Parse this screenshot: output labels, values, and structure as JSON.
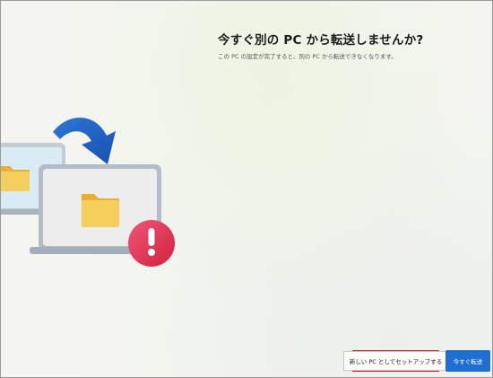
{
  "header": {
    "title": "今すぐ別の PC から転送しませんか?",
    "subtitle": "この PC の設定が完了すると、別の PC から転送できなくなります。"
  },
  "footer": {
    "setup_new_label": "新しい PC としてセットアップする",
    "transfer_now_label": "今すぐ転送"
  },
  "colors": {
    "accent": "#1f6fd1",
    "highlight_border": "#d8141e",
    "warning": "#e8334f",
    "folder": "#f2c94c"
  }
}
